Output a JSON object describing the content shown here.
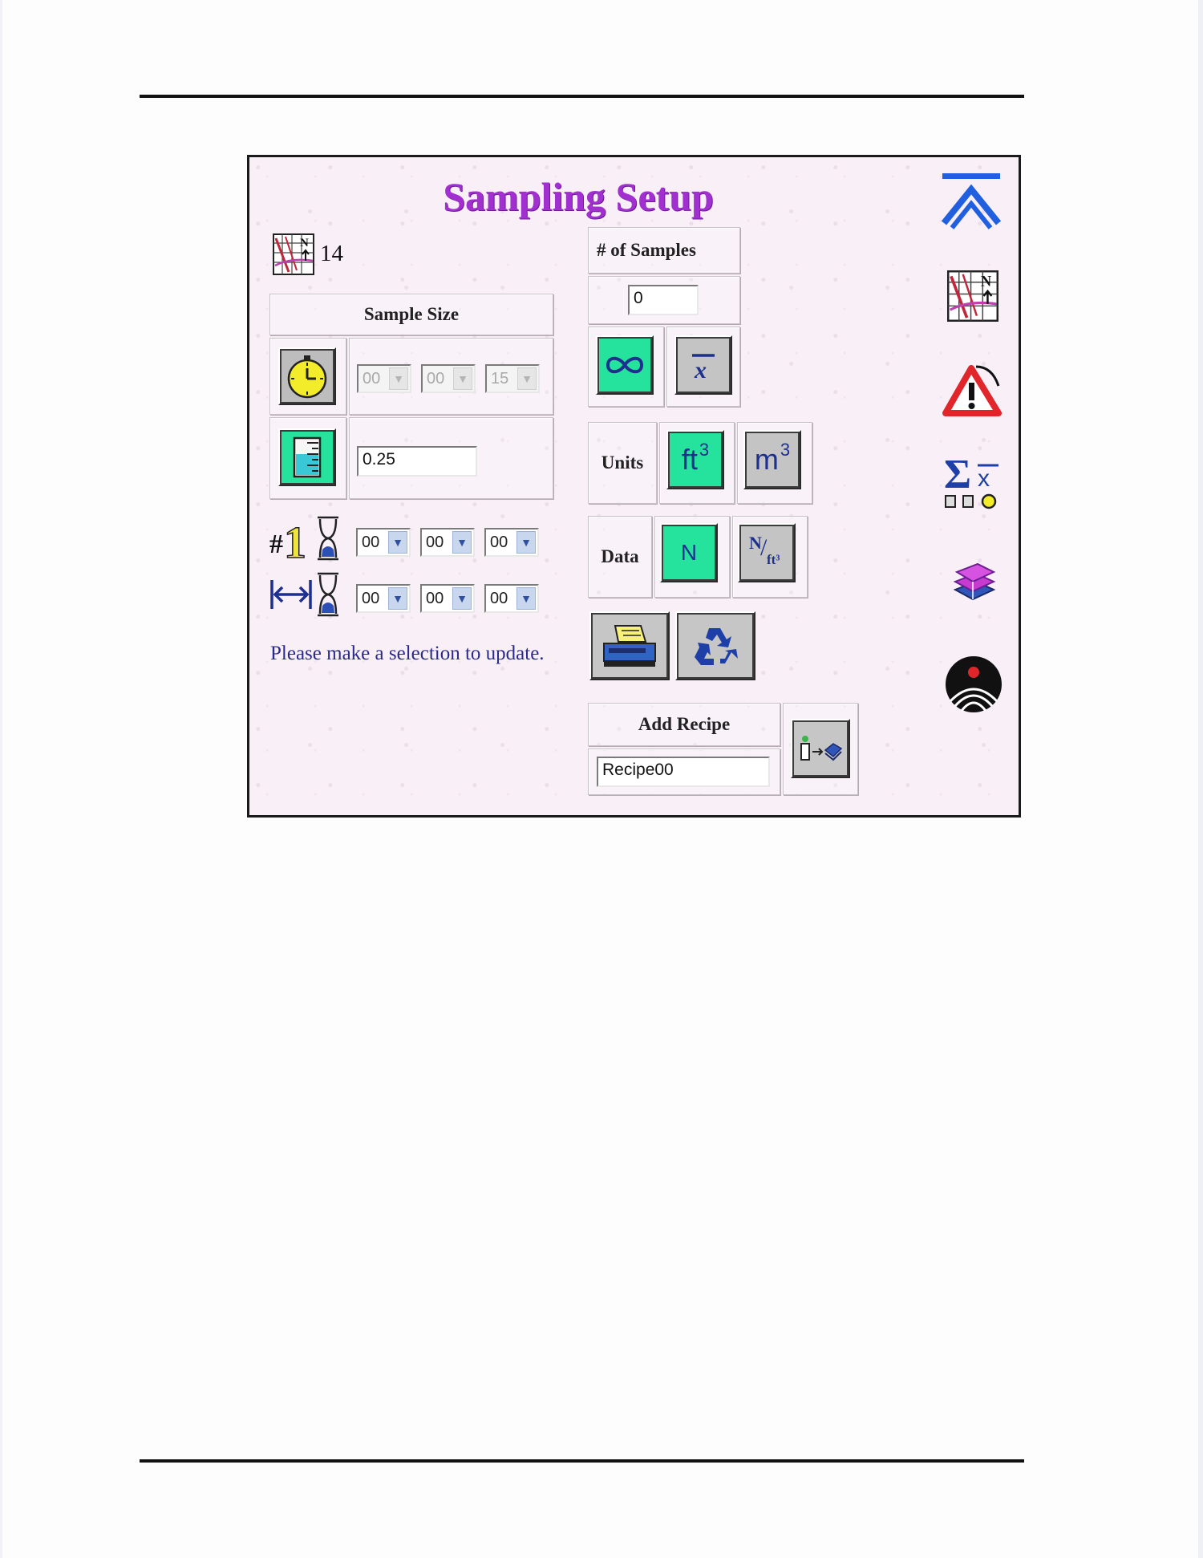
{
  "title": "Sampling Setup",
  "location_number": "14",
  "sample_size": {
    "label": "Sample Size",
    "time": {
      "hours": "00",
      "minutes": "00",
      "seconds": "15"
    },
    "volume": "0.25"
  },
  "first_sample_delay": {
    "hours": "00",
    "minutes": "00",
    "seconds": "00"
  },
  "interval": {
    "hours": "00",
    "minutes": "00",
    "seconds": "00"
  },
  "status_message": "Please make a selection to update.",
  "samples": {
    "label": "# of Samples",
    "value": "0"
  },
  "units": {
    "label": "Units",
    "ft3": "ft",
    "m3": "m",
    "exp": "3"
  },
  "data": {
    "label": "Data",
    "n": "N",
    "n_frac_num": "N",
    "n_frac_den": "ft³"
  },
  "recipe": {
    "label": "Add Recipe",
    "name": "Recipe00"
  },
  "sidebar": [
    "top-icon",
    "location-grid-icon",
    "alarm-icon",
    "statistics-icon",
    "books-icon",
    "logo-icon"
  ],
  "colors": {
    "title": "#a22fd0",
    "active_button": "#25e39c",
    "panel_bg": "#f9eff7",
    "msg_text": "#2a2a8a"
  }
}
